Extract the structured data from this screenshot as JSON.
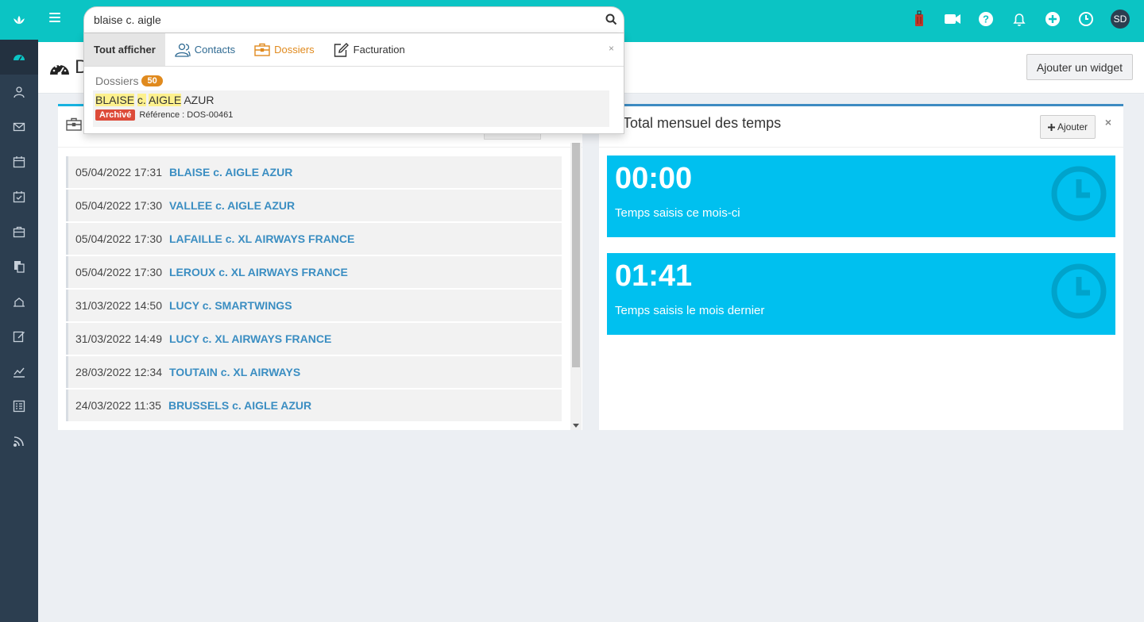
{
  "topbar": {
    "user_initials": "SD",
    "icons": [
      "menu-icon",
      "suitcase-icon",
      "video-icon",
      "help-icon",
      "bell-icon",
      "plus-circle-icon",
      "clock-icon"
    ]
  },
  "sidebar": {
    "items": [
      "dashboard-icon",
      "contacts-icon",
      "mail-icon",
      "calendar-icon",
      "tasks-icon",
      "briefcase-icon",
      "documents-icon",
      "billing-icon",
      "edit-icon",
      "chart-icon",
      "list-icon",
      "rss-icon"
    ]
  },
  "header": {
    "title_visible": "D",
    "add_widget_label": "Ajouter un widget"
  },
  "search": {
    "query": "blaise c. aigle",
    "tabs": {
      "all": "Tout afficher",
      "contacts": "Contacts",
      "dossiers": "Dossiers",
      "facturation": "Facturation"
    },
    "close": "×",
    "section_title": "Dossiers",
    "section_count": "50",
    "result": {
      "hl1": "BLAISE",
      "hl2": "c.",
      "hl3": "AIGLE",
      "rest": "AZUR",
      "status": "Archivé",
      "reference": "Référence : DOS-00461"
    }
  },
  "recent_dossiers": [
    {
      "date": "05/04/2022 17:31",
      "name": "BLAISE c. AIGLE AZUR"
    },
    {
      "date": "05/04/2022 17:30",
      "name": "VALLEE c. AIGLE AZUR"
    },
    {
      "date": "05/04/2022 17:30",
      "name": "LAFAILLE c. XL AIRWAYS FRANCE"
    },
    {
      "date": "05/04/2022 17:30",
      "name": "LEROUX c. XL AIRWAYS FRANCE"
    },
    {
      "date": "31/03/2022 14:50",
      "name": "LUCY c. SMARTWINGS"
    },
    {
      "date": "31/03/2022 14:49",
      "name": "LUCY c. XL AIRWAYS FRANCE"
    },
    {
      "date": "28/03/2022 12:34",
      "name": "TOUTAIN c. XL AIRWAYS"
    },
    {
      "date": "24/03/2022 11:35",
      "name": "BRUSSELS c. AIGLE AZUR"
    }
  ],
  "time_widget": {
    "title": "Total mensuel des temps",
    "add_label": "Ajouter",
    "close": "×",
    "this_month": {
      "value": "00:00",
      "label": "Temps saisis ce mois-ci"
    },
    "last_month": {
      "value": "01:41",
      "label": "Temps saisis le mois dernier"
    }
  },
  "colors": {
    "brand": "#0bc4c4",
    "sidebar": "#2c3e50",
    "link": "#3b8ec2",
    "info_box": "#00c0ef",
    "dossier_orange": "#e08a1e",
    "archive_red": "#dd4b39"
  }
}
